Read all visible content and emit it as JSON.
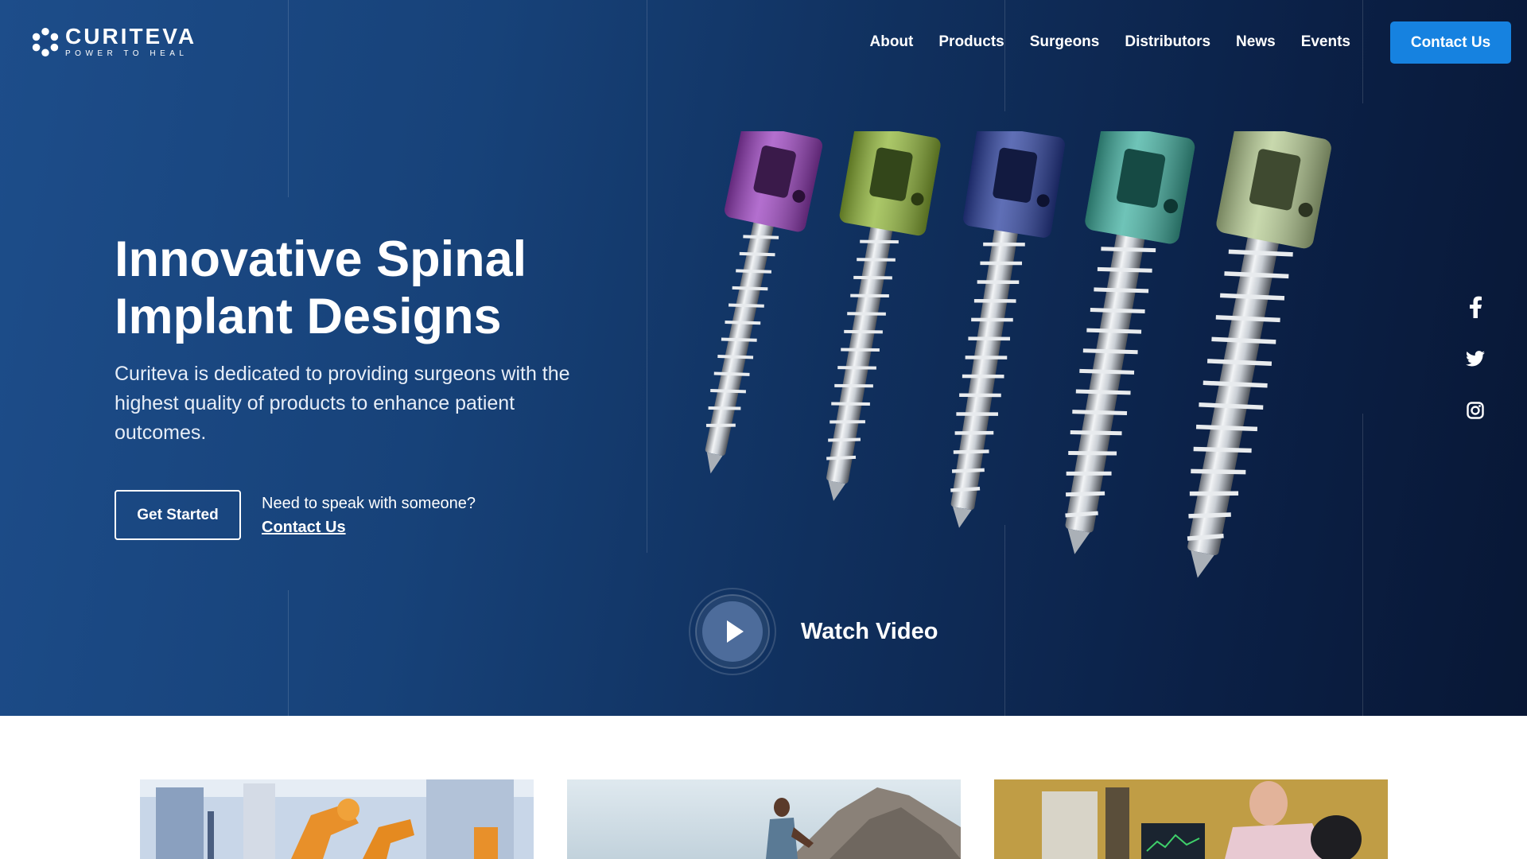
{
  "brand": {
    "name": "CURITEVA",
    "tagline": "POWER TO HEAL"
  },
  "nav": {
    "items": [
      {
        "label": "About"
      },
      {
        "label": "Products"
      },
      {
        "label": "Surgeons"
      },
      {
        "label": "Distributors"
      },
      {
        "label": "News"
      },
      {
        "label": "Events"
      }
    ],
    "cta_label": "Contact Us"
  },
  "hero": {
    "title_line1": "Innovative Spinal",
    "title_line2": "Implant Designs",
    "description": "Curiteva is dedicated to providing surgeons with the highest quality of products to enhance patient outcomes.",
    "primary_button": "Get Started",
    "speak_prompt": "Need to speak with someone?",
    "speak_link": "Contact Us",
    "video_label": "Watch Video"
  },
  "social": {
    "icons": [
      "facebook-icon",
      "twitter-icon",
      "instagram-icon"
    ]
  },
  "colors": {
    "accent": "#1682e0",
    "hero_dark": "#0b2046",
    "hero_light": "#1d4d8a",
    "screw_colors": [
      "#9a3fbf",
      "#8fb536",
      "#2a3f9e",
      "#3fb0a0",
      "#b6cc92"
    ]
  },
  "cards": [
    {
      "name": "robotic-manufacturing-image"
    },
    {
      "name": "runner-image"
    },
    {
      "name": "lab-engineers-image"
    }
  ]
}
